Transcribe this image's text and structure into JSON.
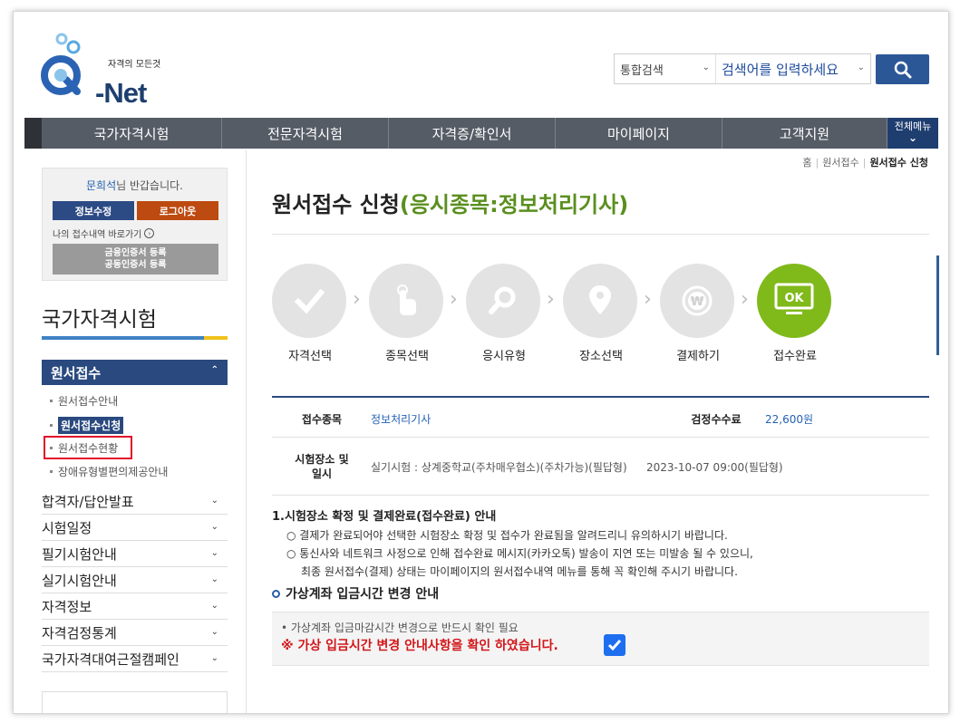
{
  "header": {
    "logo_small": "자격의 모든것",
    "logo_big": "-Net",
    "search_scope": "통합검색",
    "search_placeholder": "검색어를 입력하세요"
  },
  "gnb": {
    "items": [
      "국가자격시험",
      "전문자격시험",
      "자격증/확인서",
      "마이페이지",
      "고객지원"
    ],
    "all_menu": "전체메뉴"
  },
  "user": {
    "name": "문희석",
    "greeting_suffix": "님 반갑습니다.",
    "edit_label": "정보수정",
    "logout_label": "로그아웃",
    "my_apply": "나의 접수내역 바로가기",
    "cert_line1": "금융인증서 등록",
    "cert_line2": "공동인증서 등록"
  },
  "sidebar": {
    "title": "국가자격시험",
    "active_menu": "원서접수",
    "sub_items": [
      "원서접수안내",
      "원서접수신청",
      "원서접수현황",
      "장애유형별편의제공안내"
    ],
    "menu_items": [
      "합격자/답안발표",
      "시험일정",
      "필기시험안내",
      "실기시험안내",
      "자격정보",
      "자격검정통계",
      "국가자격대여근절캠페인"
    ]
  },
  "breadcrumb": [
    "홈",
    "원서접수",
    "원서접수 신청"
  ],
  "page": {
    "title": "원서접수 신청",
    "title_sub": "(응시종목:정보처리기사)"
  },
  "steps": [
    "자격선택",
    "종목선택",
    "응시유형",
    "장소선택",
    "결제하기",
    "접수완료"
  ],
  "steps_done_label": "OK",
  "table": {
    "item_label": "접수종목",
    "item_value": "정보처리기사",
    "fee_label": "검정수수료",
    "fee_value": "22,600원",
    "place_label_1": "시험장소 및",
    "place_label_2": "일시",
    "place_value": "실기시험 : 상계중학교(주차매우협소)(주차가능)(필답형)",
    "date_value": "2023-10-07 09:00(필답형)"
  },
  "notice": {
    "heading": "1.시험장소 확정 및 결제완료(접수완료) 안내",
    "line1": "○ 결제가 완료되어야 선택한 시험장소 확정 및 접수가 완료됨을 알려드리니 유의하시기 바랍니다.",
    "line2": "○ 통신사와 네트워크 사정으로 인해 접수완료 메시지(카카오톡) 발송이 지연 또는 미발송 될 수 있으니,",
    "line3": "최종 원서접수(결제) 상태는 마이페이지의 원서접수내역 메뉴를 통해 꼭 확인해 주시기 바랍니다."
  },
  "vbank": {
    "heading": "가상계좌 입금시간 변경 안내",
    "line1": "• 가상계좌 입금마감시간 변경으로 반드시 확인 필요",
    "line2": "※ 가상 입금시간 변경 안내사항을 확인 하였습니다.",
    "checked": true
  }
}
